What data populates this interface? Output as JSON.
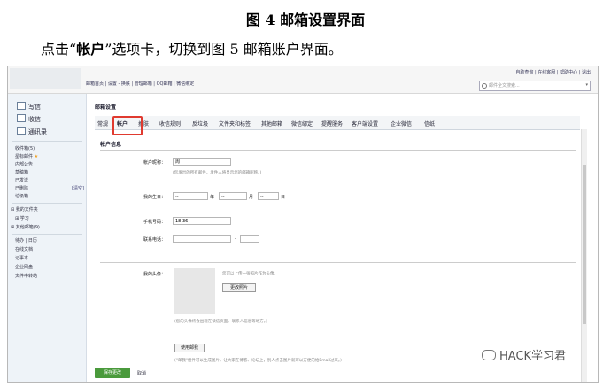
{
  "doc": {
    "caption": "图 4  邮箱设置界面",
    "para_before": "点击“",
    "para_bold": "帐户",
    "para_after": "”选项卡，切换到图 5 邮箱账户界面。"
  },
  "topbar": {
    "links": "邮箱首页 | 设置 - 换肤 | 管理邮箱 | QQ邮箱 | 微信绑定",
    "right_links": "自助查询 | 在线客服 | 帮助中心 | 退出",
    "search_placeholder": "邮件全文搜索..."
  },
  "sidebar": {
    "write": "写信",
    "inbox": "收信",
    "contacts": "通讯录",
    "items": [
      "收件箱(5)",
      "星标邮件",
      "内部公告",
      "草稿箱",
      "已发送",
      "已删除",
      "垃圾箱"
    ],
    "clear": "[清空]",
    "my_folders": "我的文件夹",
    "study": "学习",
    "other_mail": "其他邮箱(9)",
    "tools": [
      "待办 | 日历",
      "在线文档",
      "记事本",
      "企业网盘",
      "文件中转站"
    ]
  },
  "settings": {
    "title": "邮箱设置",
    "tabs": [
      "常规",
      "帐户",
      "换肤",
      "收信规则",
      "反垃圾",
      "文件夹和标签",
      "其他邮箱",
      "微信绑定",
      "提醒服务",
      "客户端设置",
      "企业微信",
      "信纸"
    ],
    "active_tab": "帐户",
    "section": "帐户信息",
    "nickname_label": "帐户昵称：",
    "nickname_value": "周",
    "nickname_hint": "(您发出的所有邮件，发件人将显示您的邮箱昵称。)",
    "birthday_label": "我的生日：",
    "birthday_year": "--",
    "birthday_year_unit": "年",
    "birthday_month": "--",
    "birthday_month_unit": "月",
    "birthday_day": "--",
    "birthday_day_unit": "日",
    "phone_label": "手机号码：",
    "phone_value": "18             36",
    "tel_label": "联系电话：",
    "tel_dash": "-",
    "avatar_label": "我的头像：",
    "avatar_hint": "您可以上传一张照片作为头像。",
    "change_photo": "更改照片",
    "avatar_note": "(您的头像将会出现在读信页面、联系人信息等地方。)",
    "use_avatar": "使用邮我",
    "use_avatar_note": "(\"邮我\"组件可以生成图片，让大家在博客、论坛上，别人点击图片就可以方便的给Email过来。)",
    "save": "保存更改",
    "cancel": "取消"
  },
  "watermark": "HACK学习君",
  "colors": {
    "highlight": "#e03a2f",
    "save": "#4a9a3c"
  }
}
